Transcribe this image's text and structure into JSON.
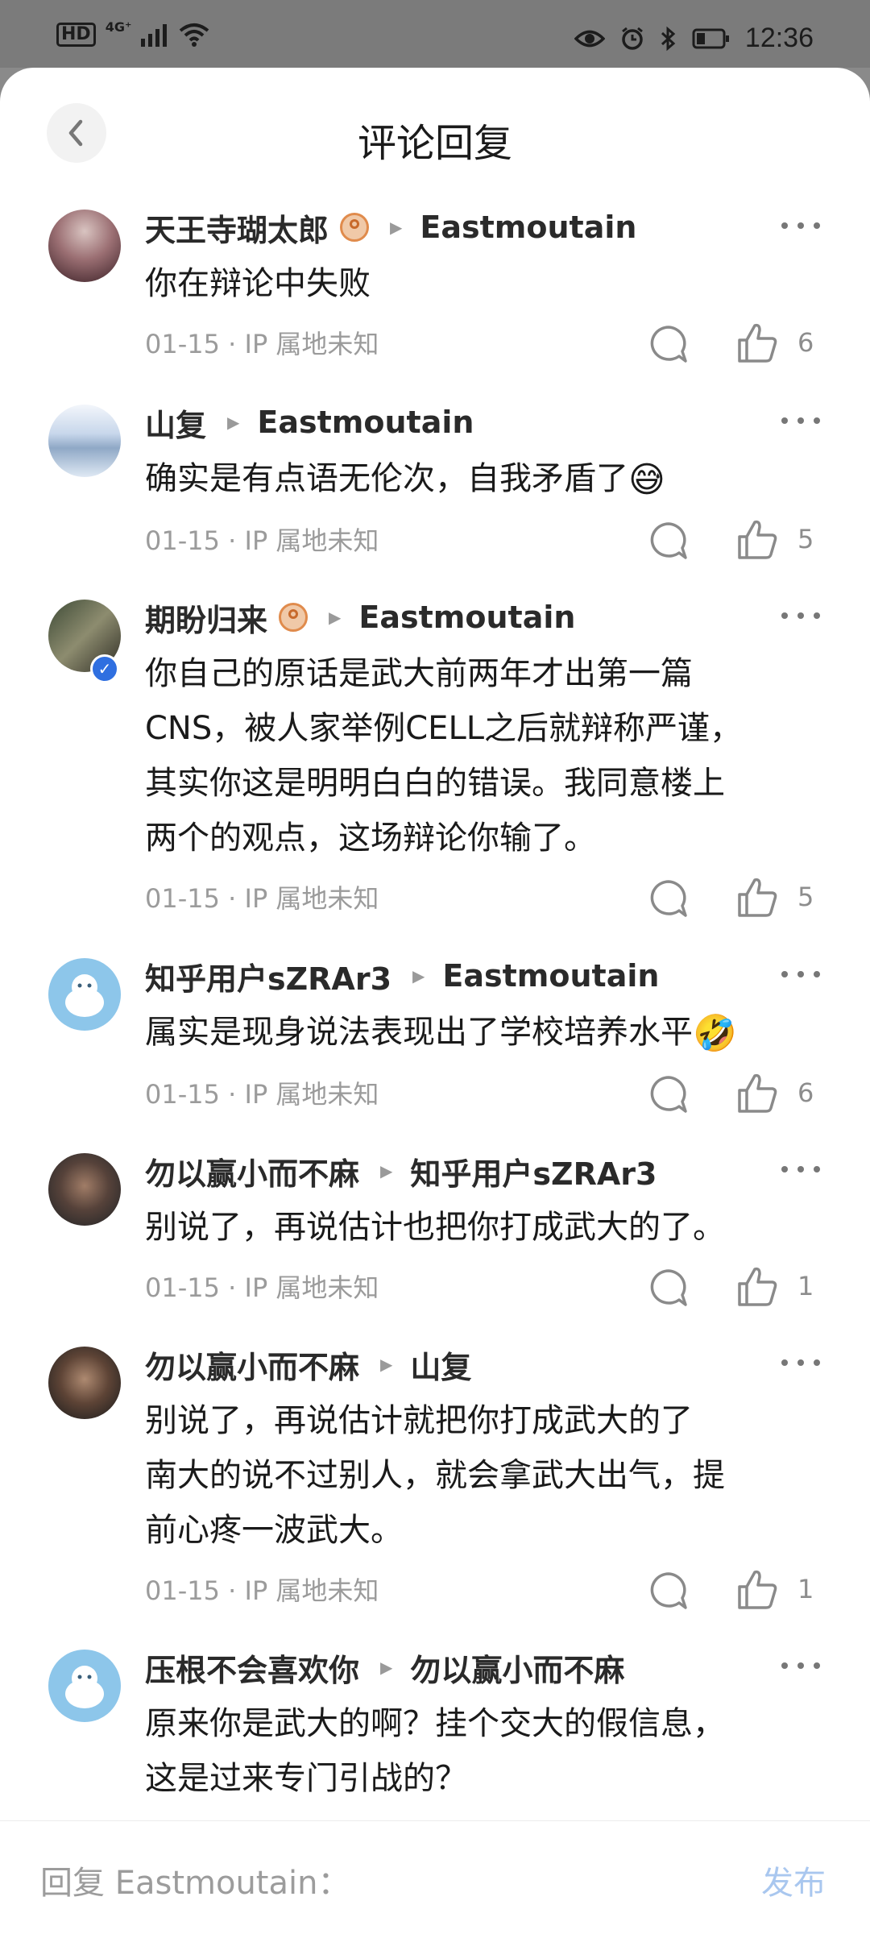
{
  "status_bar": {
    "left_labels": {
      "hd": "HD",
      "network": "4G⁺"
    },
    "time": "12:36"
  },
  "header": {
    "title": "评论回复"
  },
  "comments": [
    {
      "author": "天王寺瑚太郎",
      "has_badge": true,
      "reply_to": "Eastmoutain",
      "text": "你在辩论中失败",
      "meta": "01-15 · IP 属地未知",
      "likes": "6"
    },
    {
      "author": "山复",
      "has_badge": false,
      "reply_to": "Eastmoutain",
      "text": "确实是有点语无伦次，自我矛盾了",
      "emoji": "😅",
      "meta": "01-15 · IP 属地未知",
      "likes": "5"
    },
    {
      "author": "期盼归来",
      "has_badge": true,
      "verified": true,
      "reply_to": "Eastmoutain",
      "text_lines": [
        "你自己的原话是武大前两年才出第一篇",
        "CNS，被人家举例CELL之后就辩称严谨，",
        "其实你这是明明白白的错误。我同意楼上",
        "两个的观点，这场辩论你输了。"
      ],
      "meta": "01-15 · IP 属地未知",
      "likes": "5"
    },
    {
      "author": "知乎用户sZRAr3",
      "has_badge": false,
      "reply_to": "Eastmoutain",
      "text": "属实是现身说法表现出了学校培养水平",
      "emoji": "🤣",
      "meta": "01-15 · IP 属地未知",
      "likes": "6"
    },
    {
      "author": "勿以赢小而不麻",
      "has_badge": false,
      "reply_to": "知乎用户sZRAr3",
      "text": "别说了，再说估计也把你打成武大的了。",
      "meta": "01-15 · IP 属地未知",
      "likes": "1"
    },
    {
      "author": "勿以赢小而不麻",
      "has_badge": false,
      "reply_to": "山复",
      "text_lines": [
        "别说了，再说估计就把你打成武大的了",
        "南大的说不过别人，就会拿武大出气，提",
        "前心疼一波武大。"
      ],
      "meta": "01-15 · IP 属地未知",
      "likes": "1"
    },
    {
      "author": "压根不会喜欢你",
      "has_badge": false,
      "reply_to": "勿以赢小而不麻",
      "text_lines": [
        "原来你是武大的啊？挂个交大的假信息，",
        "这是过来专门引战的？"
      ]
    }
  ],
  "reply_bar": {
    "placeholder": "回复 Eastmoutain：",
    "send_label": "发布"
  },
  "colors": {
    "send_disabled": "#a9c7ef",
    "meta_gray": "#9b9b9b",
    "verified_blue": "#2f6fe0"
  }
}
